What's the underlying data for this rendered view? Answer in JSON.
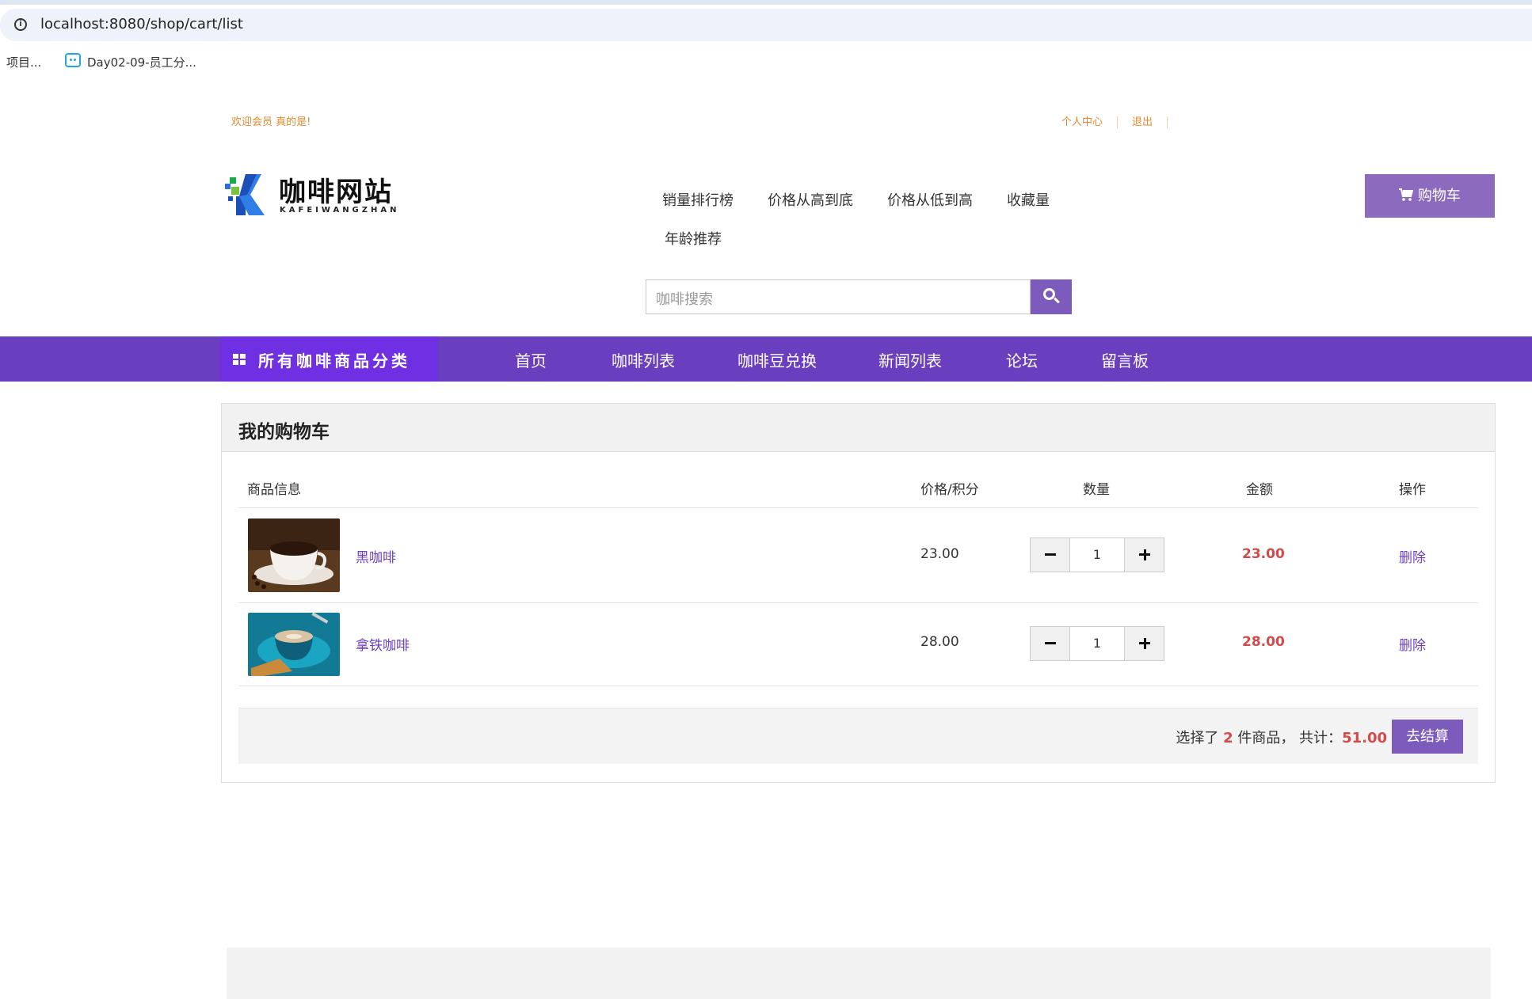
{
  "browser": {
    "url": "localhost:8080/shop/cart/list",
    "bookmarks": [
      "项目...",
      "Day02-09-员工分..."
    ]
  },
  "header": {
    "welcome": "欢迎会员 真的是!",
    "links": [
      "个人中心",
      "退出"
    ],
    "logo_title": "咖啡网站",
    "logo_sub": "KAFEIWANGZHAN",
    "sort_links": [
      "销量排行榜",
      "价格从高到底",
      "价格从低到高",
      "收藏量",
      "年龄推荐"
    ],
    "cart_label": "购物车",
    "search_placeholder": "咖啡搜索"
  },
  "nav": {
    "category_label": "所有咖啡商品分类",
    "items": [
      "首页",
      "咖啡列表",
      "咖啡豆兑换",
      "新闻列表",
      "论坛",
      "留言板"
    ]
  },
  "cart": {
    "title": "我的购物车",
    "columns": [
      "商品信息",
      "价格/积分",
      "数量",
      "金额",
      "操作"
    ],
    "rows": [
      {
        "name": "黑咖啡",
        "price": "23.00",
        "qty": "1",
        "amount": "23.00",
        "action": "删除"
      },
      {
        "name": "拿铁咖啡",
        "price": "28.00",
        "qty": "1",
        "amount": "28.00",
        "action": "删除"
      }
    ],
    "summary_prefix": "选择了",
    "selected_count": "2",
    "summary_mid": "件商品，  共计：",
    "total": "51.00",
    "checkout_label": "去结算"
  },
  "colors": {
    "brand_purple": "#6a3fbf",
    "accent_orange": "#e38a2c",
    "price_red": "#d24a4a"
  }
}
